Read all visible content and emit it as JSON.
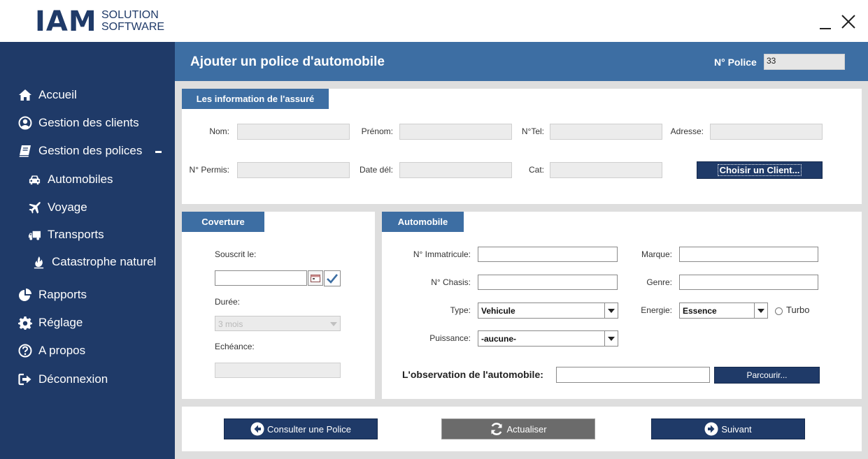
{
  "app": {
    "logo_main": "IAM",
    "logo_sub_1": "SOLUTION",
    "logo_sub_2": "SOFTWARE"
  },
  "sidebar": {
    "items": [
      {
        "label": "Accueil",
        "icon": "home-icon"
      },
      {
        "label": "Gestion des clients",
        "icon": "user-circle-icon"
      },
      {
        "label": "Gestion des polices",
        "icon": "book-icon",
        "expanded": true
      },
      {
        "label": "Automobiles",
        "icon": "car-icon"
      },
      {
        "label": "Voyage",
        "icon": "plane-icon"
      },
      {
        "label": "Transports",
        "icon": "truck-icon"
      },
      {
        "label": "Catastrophe naturel",
        "icon": "fire-icon"
      },
      {
        "label": "Rapports",
        "icon": "pie-chart-icon"
      },
      {
        "label": "Réglage",
        "icon": "gear-icon"
      },
      {
        "label": "A propos",
        "icon": "question-icon"
      },
      {
        "label": "Déconnexion",
        "icon": "sign-out-icon"
      }
    ]
  },
  "header": {
    "title": "Ajouter un police d'automobile",
    "police_label": "N° Police",
    "police_value": "33"
  },
  "assure": {
    "tab": "Les information de l'assuré",
    "nom_label": "Nom:",
    "prenom_label": "Prénom:",
    "tel_label": "N°Tel:",
    "adresse_label": "Adresse:",
    "permis_label": "N° Permis:",
    "date_label": "Date dél:",
    "cat_label": "Cat:",
    "choose_button": "Choisir un Client..."
  },
  "couverture": {
    "tab": "Coverture",
    "souscrit_label": "Souscrit le:",
    "duree_label": "Durée:",
    "duree_value": "3 mois",
    "echeance_label": "Echéance:"
  },
  "automobile": {
    "tab": "Automobile",
    "immatricule_label": "N° Immatricule:",
    "marque_label": "Marque:",
    "chasis_label": "N° Chasis:",
    "genre_label": "Genre:",
    "type_label": "Type:",
    "type_value": "Vehicule",
    "energie_label": "Energie:",
    "energie_value": "Essence",
    "turbo_label": "Turbo",
    "puissance_label": "Puissance:",
    "puissance_value": "-aucune-",
    "observation_label": "L'observation de l'automobile:",
    "parcourir_button": "Parcourir..."
  },
  "footer": {
    "consulter": "Consulter une Police",
    "actualiser": "Actualiser",
    "suivant": "Suivant"
  },
  "colors": {
    "sidebar": "#1f3a68",
    "header": "#3d6ea3",
    "gray_button": "#6b6b6b"
  }
}
